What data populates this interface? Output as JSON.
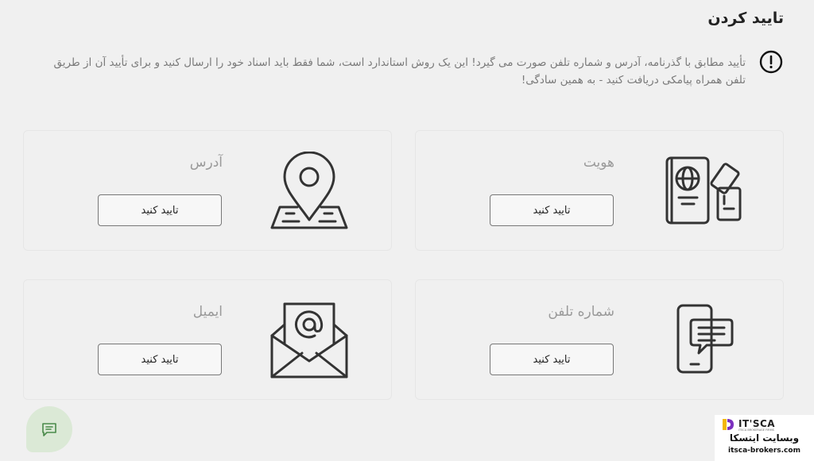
{
  "header": {
    "title": "تایید کردن"
  },
  "notice": {
    "icon": "exclamation-circle-icon",
    "text": "تأیید مطابق با گذرنامه، آدرس و شماره تلفن صورت می گیرد! این یک روش استاندارد است، شما فقط باید اسناد خود را ارسال کنید و برای تأیید آن از طریق تلفن همراه پیامکی دریافت کنید - به همین سادگی!"
  },
  "cards": {
    "identity": {
      "label": "هویت",
      "button": "تایید کنید",
      "icon": "passport-icon"
    },
    "address": {
      "label": "آدرس",
      "button": "تایید کنید",
      "icon": "map-pin-icon"
    },
    "phone": {
      "label": "شماره تلفن",
      "button": "تایید کنید",
      "icon": "phone-message-icon"
    },
    "email": {
      "label": "ایمیل",
      "button": "تایید کنید",
      "icon": "envelope-at-icon"
    }
  },
  "chat": {
    "icon": "chat-icon",
    "color": "#dbe9d6"
  },
  "watermark": {
    "brand": "IT'SCA",
    "sub": "ITSCA BROKERAGE FIRMS",
    "title": "وبسایت ایتسکا",
    "url": "itsca-brokers.com"
  }
}
